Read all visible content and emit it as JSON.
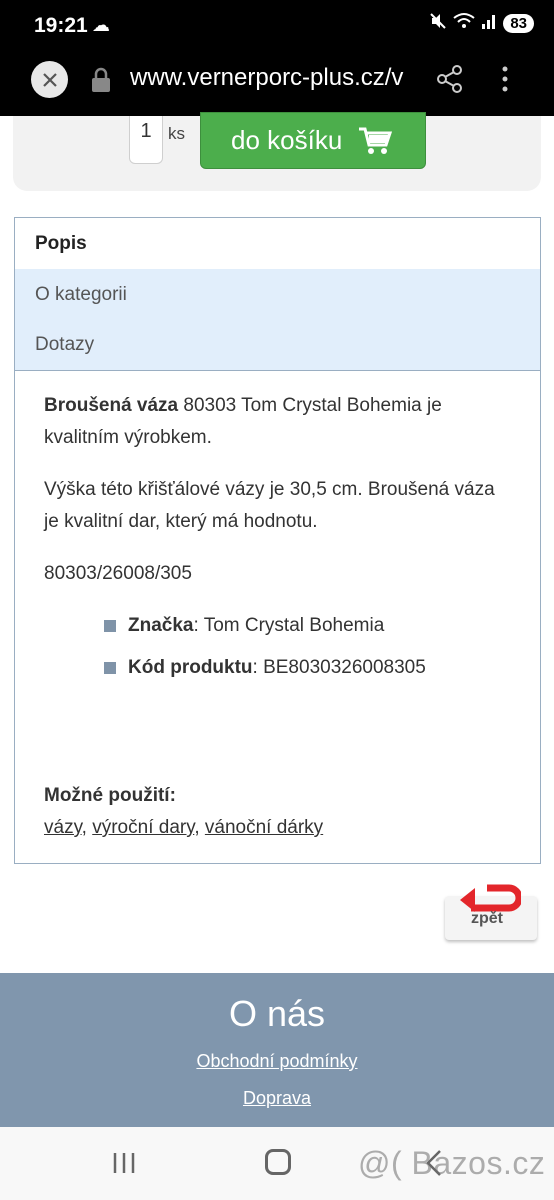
{
  "status_bar": {
    "time": "19:21",
    "battery": "83",
    "icons": [
      "cloud-icon",
      "mute-icon",
      "wifi-icon",
      "signal-icon"
    ]
  },
  "browser": {
    "url": "www.vernerporc-plus.cz/v",
    "icons": [
      "close-icon",
      "lock-icon",
      "share-icon",
      "more-vert-icon"
    ]
  },
  "buy": {
    "quantity": "1",
    "unit": "ks",
    "cart_label": "do košíku",
    "button_color": "#4cae4c"
  },
  "tabs": [
    {
      "label": "Popis",
      "active": true
    },
    {
      "label": "O kategorii",
      "active": false
    },
    {
      "label": "Dotazy",
      "active": false
    }
  ],
  "description": {
    "p1_bold": "Broušená váza",
    "p1_rest": " 80303 Tom Crystal Bohemia je kvalitním výrobkem.",
    "p2": "Výška této křišťálové vázy je 30,5 cm. Broušená váza je kvalitní dar, který má hodnotu.",
    "p3": "80303/26008/305",
    "attributes": [
      {
        "label": "Značka",
        "value": ": Tom Crystal Bohemia"
      },
      {
        "label": "Kód produktu",
        "value": ": BE8030326008305"
      }
    ],
    "usage_label": "Možné použití:",
    "usage_links": [
      "vázy",
      "výroční dary",
      "vánoční dárky"
    ],
    "usage_separator": ", "
  },
  "back_button": {
    "label": "zpět",
    "arrow_color": "#e3262b"
  },
  "footer": {
    "title": "O nás",
    "links": [
      "Obchodní podmínky",
      "Doprava"
    ],
    "background": "#8096ad"
  },
  "nav_bar": {
    "icons": [
      "recent-apps-icon",
      "home-icon",
      "back-icon"
    ],
    "watermark": "@( Bazos.cz"
  }
}
